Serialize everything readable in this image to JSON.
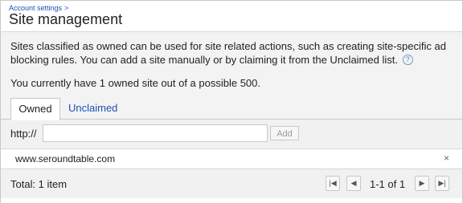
{
  "breadcrumb": {
    "link_text": "Account settings",
    "separator": ">"
  },
  "page_title": "Site management",
  "description": "Sites classified as owned can be used for site related actions, such as creating site-specific ad blocking rules. You can add a site manually or by claiming it from the Unclaimed list.",
  "help_icon": {
    "name": "help-icon",
    "glyph": "?"
  },
  "owned_count_text": "You currently have 1 owned site out of a possible 500.",
  "tabs": [
    {
      "label": "Owned",
      "active": true
    },
    {
      "label": "Unclaimed",
      "active": false
    }
  ],
  "add_form": {
    "prefix": "http://",
    "input_value": "",
    "input_placeholder": "",
    "add_label": "Add"
  },
  "sites": [
    {
      "url": "www.seroundtable.com",
      "remove_glyph": "×"
    }
  ],
  "footer": {
    "total_text": "Total: 1 item",
    "page_range": "1-1 of 1",
    "first_glyph": "|◀",
    "prev_glyph": "◀",
    "next_glyph": "▶",
    "last_glyph": "▶|"
  },
  "colors": {
    "link": "#1a52b6",
    "panel_bg": "#f3f3f3",
    "border": "#c9c9c9"
  }
}
